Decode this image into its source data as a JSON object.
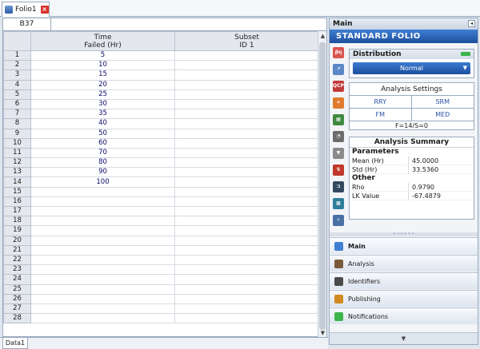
{
  "doc_tab": {
    "label": "Folio1"
  },
  "name_box": "B37",
  "columns": [
    {
      "line1": "Time",
      "line2": "Failed (Hr)"
    },
    {
      "line1": "Subset",
      "line2": "ID 1"
    }
  ],
  "rows": [
    {
      "n": "1",
      "time": "5",
      "subset": ""
    },
    {
      "n": "2",
      "time": "10",
      "subset": ""
    },
    {
      "n": "3",
      "time": "15",
      "subset": ""
    },
    {
      "n": "4",
      "time": "20",
      "subset": ""
    },
    {
      "n": "5",
      "time": "25",
      "subset": ""
    },
    {
      "n": "6",
      "time": "30",
      "subset": ""
    },
    {
      "n": "7",
      "time": "35",
      "subset": ""
    },
    {
      "n": "8",
      "time": "40",
      "subset": ""
    },
    {
      "n": "9",
      "time": "50",
      "subset": ""
    },
    {
      "n": "10",
      "time": "60",
      "subset": ""
    },
    {
      "n": "11",
      "time": "70",
      "subset": ""
    },
    {
      "n": "12",
      "time": "80",
      "subset": ""
    },
    {
      "n": "13",
      "time": "90",
      "subset": ""
    },
    {
      "n": "14",
      "time": "100",
      "subset": ""
    },
    {
      "n": "15",
      "time": "",
      "subset": ""
    },
    {
      "n": "16",
      "time": "",
      "subset": ""
    },
    {
      "n": "17",
      "time": "",
      "subset": ""
    },
    {
      "n": "18",
      "time": "",
      "subset": ""
    },
    {
      "n": "19",
      "time": "",
      "subset": ""
    },
    {
      "n": "20",
      "time": "",
      "subset": ""
    },
    {
      "n": "21",
      "time": "",
      "subset": ""
    },
    {
      "n": "22",
      "time": "",
      "subset": ""
    },
    {
      "n": "23",
      "time": "",
      "subset": ""
    },
    {
      "n": "24",
      "time": "",
      "subset": ""
    },
    {
      "n": "25",
      "time": "",
      "subset": ""
    },
    {
      "n": "26",
      "time": "",
      "subset": ""
    },
    {
      "n": "27",
      "time": "",
      "subset": ""
    },
    {
      "n": "28",
      "time": "",
      "subset": ""
    }
  ],
  "sheet_tab": "Data1",
  "panel": {
    "header": "Main",
    "folio_title": "Standard Folio",
    "distribution": {
      "label": "Distribution",
      "value": "Normal"
    },
    "analysis_settings": {
      "title": "Analysis Settings",
      "options": [
        "RRY",
        "SRM",
        "FM",
        "MED"
      ],
      "footer": "F=14/S=0"
    },
    "summary": {
      "title": "Analysis Summary",
      "parameters_label": "Parameters",
      "parameters": [
        {
          "k": "Mean (Hr)",
          "v": "45.0000"
        },
        {
          "k": "Std (Hr)",
          "v": "33.5360"
        }
      ],
      "other_label": "Other",
      "other": [
        {
          "k": "Rho",
          "v": "0.9790"
        },
        {
          "k": "LK Value",
          "v": "-67.4879"
        }
      ]
    },
    "nav": [
      "Main",
      "Analysis",
      "Identifiers",
      "Publishing",
      "Notifications"
    ]
  },
  "colors": {
    "accent": "#1d4f9d",
    "selection_green": "#3cb54a",
    "value_text": "#0a0a6a"
  }
}
